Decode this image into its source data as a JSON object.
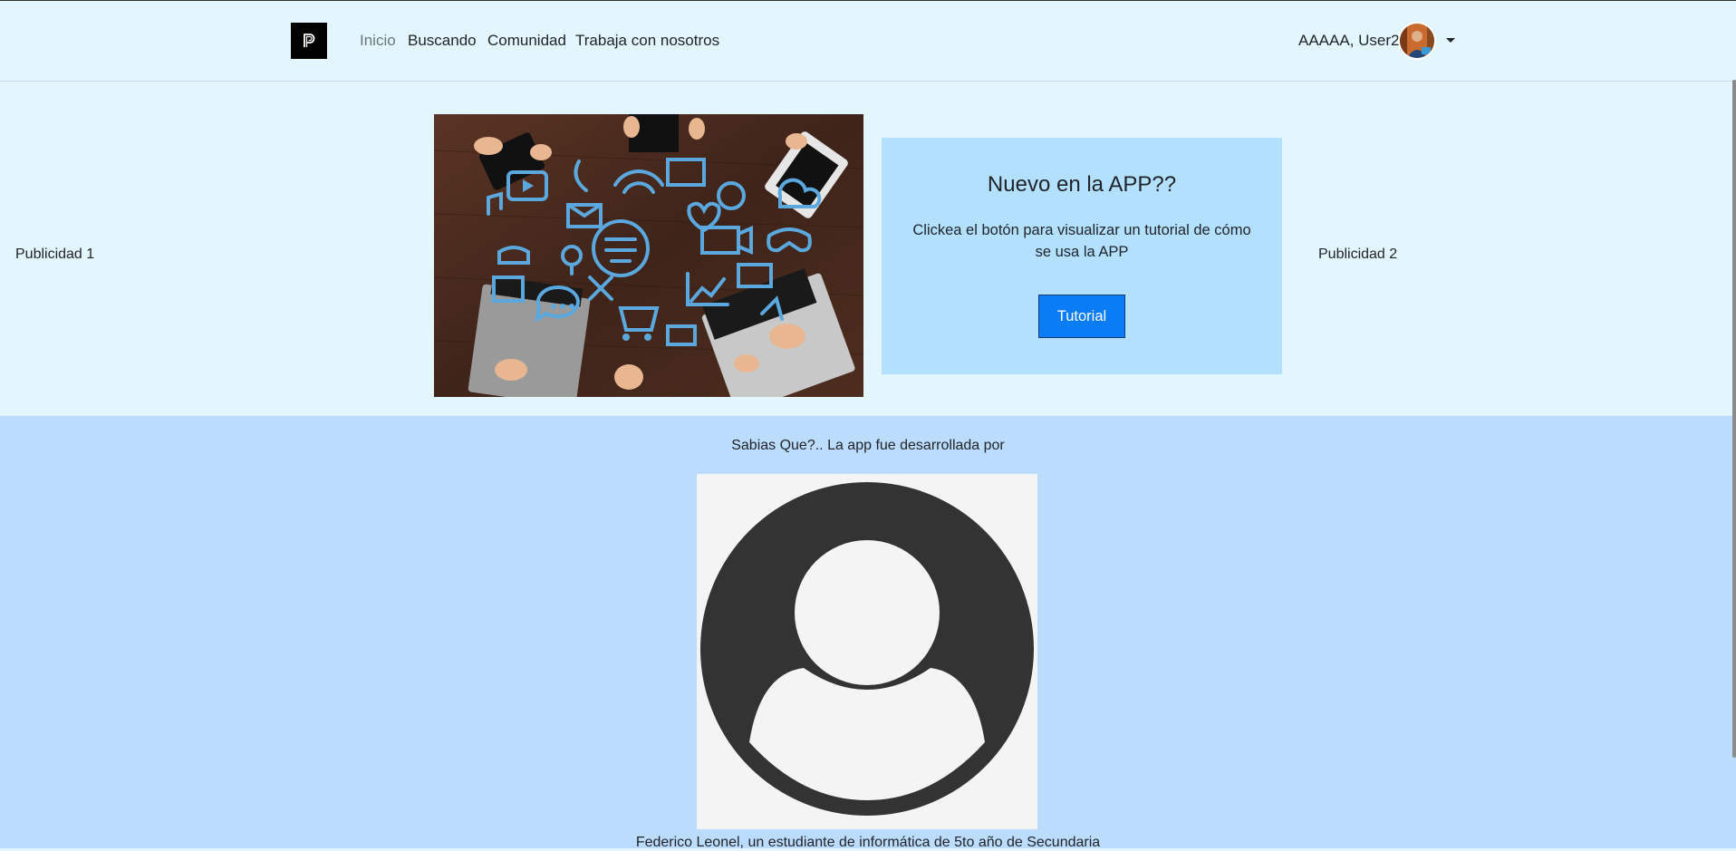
{
  "nav": {
    "links": [
      "Inicio",
      "Buscando",
      "Comunidad",
      "Trabaja con nosotros"
    ],
    "user_label": "AAAAA, User2"
  },
  "ads": {
    "left": "Publicidad 1",
    "right": "Publicidad 2"
  },
  "card": {
    "title": "Nuevo en la APP??",
    "text": "Clickea el botón para visualizar un tutorial de cómo se usa la APP",
    "button_label": "Tutorial"
  },
  "about": {
    "fact": "Sabias Que?.. La app fue desarrollada por",
    "caption": "Federico Leonel, un estudiante de informática de 5to año de Secundaria"
  },
  "icons": [
    "brand-logo-icon",
    "user-avatar-icon",
    "caret-down-icon",
    "default-profile-icon"
  ]
}
